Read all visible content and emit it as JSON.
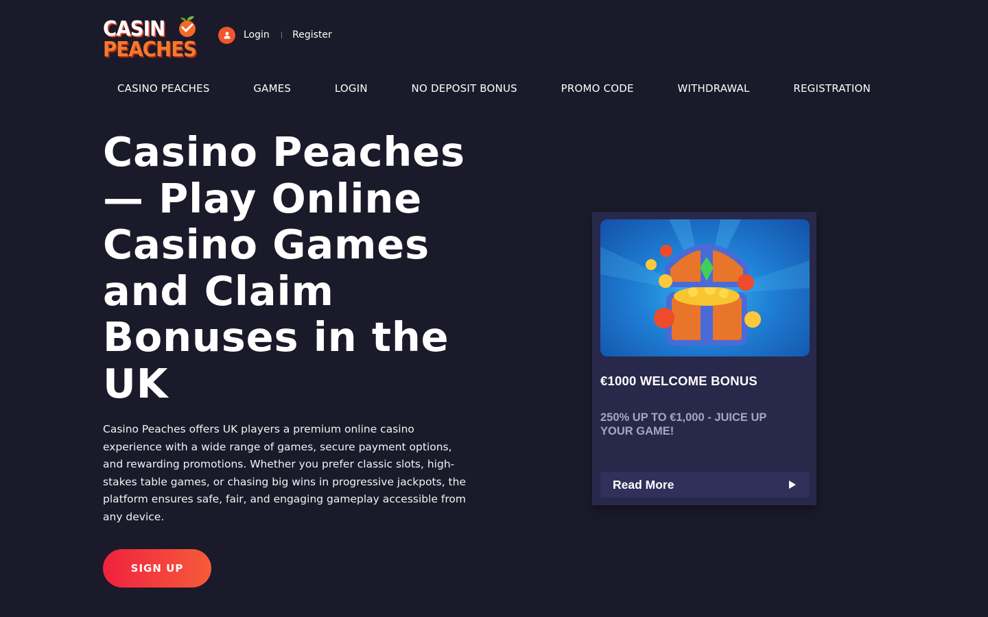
{
  "header": {
    "logo": {
      "line1": "CASIN",
      "line2": "PEACHES"
    },
    "login_label": "Login",
    "separator": "|",
    "register_label": "Register"
  },
  "nav": {
    "items": [
      {
        "label": "CASINO PEACHES"
      },
      {
        "label": "GAMES"
      },
      {
        "label": "LOGIN"
      },
      {
        "label": "NO DEPOSIT BONUS"
      },
      {
        "label": "PROMO CODE"
      },
      {
        "label": "WITHDRAWAL"
      },
      {
        "label": "REGISTRATION"
      }
    ]
  },
  "hero": {
    "title": "Casino Peaches — Play Online Casino Games and Claim Bonuses in the UK",
    "description": "Casino Peaches offers UK players a premium online casino experience with a wide range of games, secure payment options, and rewarding promotions. Whether you prefer classic slots, high-stakes table games, or chasing big wins in progressive jackpots, the platform ensures safe, fair, and engaging gameplay accessible from any device.",
    "signup_label": "SIGN UP"
  },
  "promo": {
    "title": "€1000 WELCOME BONUS",
    "subtitle": "250% UP TO €1,000 - JUICE UP YOUR GAME!",
    "read_more_label": "Read More",
    "icons": {
      "art": "treasure-chest-icon",
      "arrow": "play-arrow-icon"
    }
  },
  "colors": {
    "background": "#1a1a2a",
    "accent": "#f0562e",
    "signup_gradient_start": "#f0213f",
    "signup_gradient_end": "#f65b3a",
    "card_background": "#28284a"
  }
}
